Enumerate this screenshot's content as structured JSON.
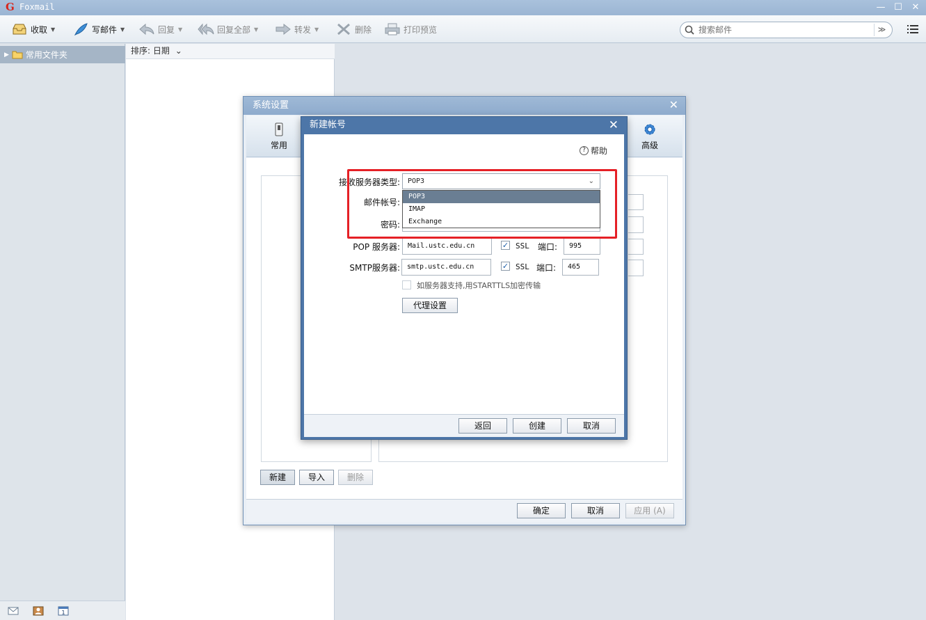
{
  "app": {
    "title": "Foxmail",
    "logo_glyph": "G"
  },
  "window_controls": {
    "minimize": "—",
    "maximize": "☐",
    "close": "✕"
  },
  "toolbar": {
    "receive": "收取",
    "compose": "写邮件",
    "reply": "回复",
    "reply_all": "回复全部",
    "forward": "转发",
    "delete": "删除",
    "print_preview": "打印预览",
    "caret": "▼"
  },
  "search": {
    "placeholder": "搜索邮件",
    "dropdown_glyph": "≫"
  },
  "sidebar": {
    "expand_glyph": "▶",
    "folder_label": "常用文件夹"
  },
  "list": {
    "sort_label": "排序: 日期",
    "sort_caret": "⌄"
  },
  "settings_dialog": {
    "title": "系统设置",
    "close_glyph": "✕",
    "tabs": {
      "general": "常用",
      "advanced": "高级"
    },
    "new_button": "新建",
    "import_button": "导入",
    "delete_button": "删除",
    "ok_button": "确定",
    "cancel_button": "取消",
    "apply_button": "应用 (A)"
  },
  "new_account_dialog": {
    "title": "新建帐号",
    "close_glyph": "✕",
    "help_glyph": "?",
    "help_label": "帮助",
    "server_type_label": "接收服务器类型:",
    "server_type_value": "POP3",
    "server_type_caret": "⌄",
    "server_type_options": [
      "POP3",
      "IMAP",
      "Exchange"
    ],
    "account_label": "邮件帐号:",
    "password_label": "密码:",
    "pop_server_label": "POP 服务器:",
    "pop_server_value": "Mail.ustc.edu.cn",
    "pop_ssl_label": "SSL",
    "pop_port_label": "端口:",
    "pop_port_value": "995",
    "smtp_server_label": "SMTP服务器:",
    "smtp_server_value": "smtp.ustc.edu.cn",
    "smtp_ssl_label": "SSL",
    "smtp_port_label": "端口:",
    "smtp_port_value": "465",
    "checkmark": "✓",
    "starttls_label": "如服务器支持,用STARTTLS加密传输",
    "proxy_button": "代理设置",
    "back_button": "返回",
    "create_button": "创建",
    "cancel_button": "取消"
  },
  "colors": {
    "highlight": "#e52026",
    "title_bar": "#9bb5d3",
    "dialog_frame": "#4d76a8"
  }
}
